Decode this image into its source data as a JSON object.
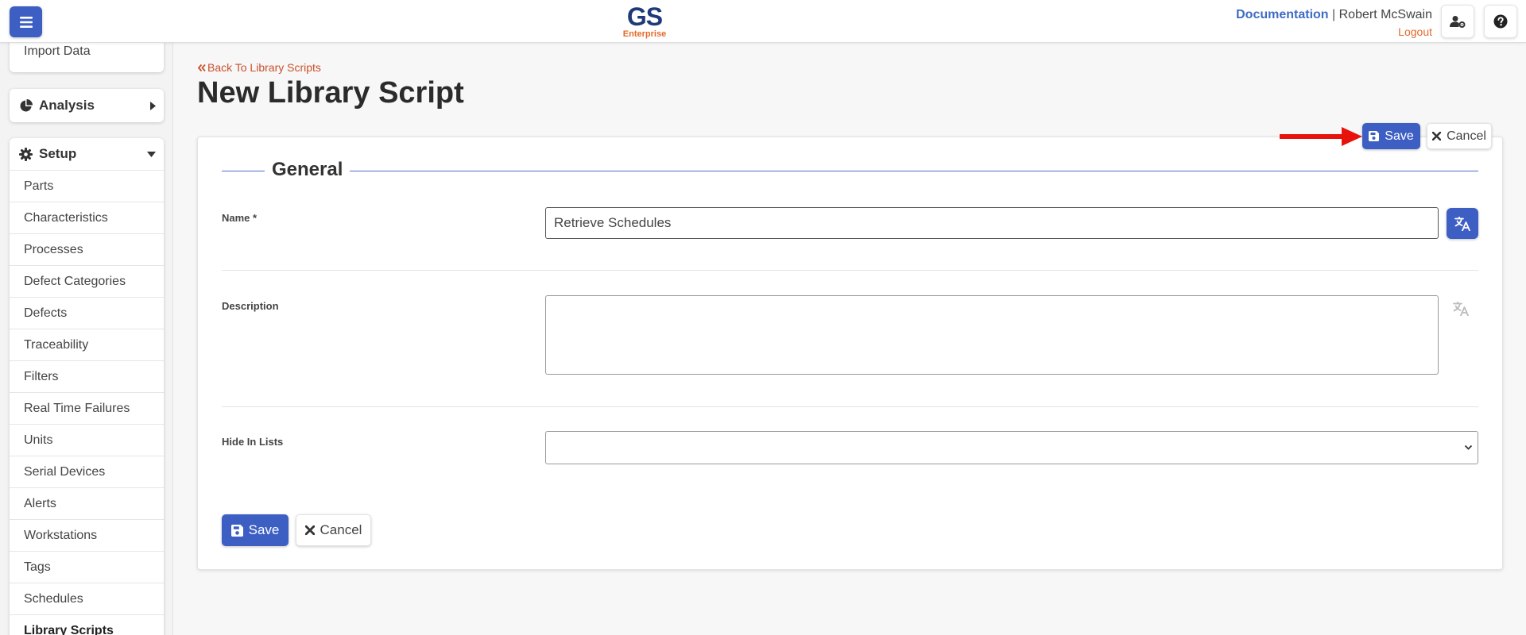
{
  "header": {
    "logo_main": "GS",
    "logo_sub": "Enterprise",
    "documentation": "Documentation",
    "separator": "|",
    "user_name": "Robert McSwain",
    "logout": "Logout",
    "icons": {
      "menu": "hamburger-icon",
      "user_settings": "user-cog-icon",
      "help": "question-circle-icon"
    }
  },
  "sidebar": {
    "import_data": "Import Data",
    "analysis": {
      "label": "Analysis",
      "icon": "chart-pie-icon"
    },
    "setup": {
      "label": "Setup",
      "icon": "gear-icon",
      "items": [
        {
          "label": "Parts"
        },
        {
          "label": "Characteristics"
        },
        {
          "label": "Processes"
        },
        {
          "label": "Defect Categories"
        },
        {
          "label": "Defects"
        },
        {
          "label": "Traceability"
        },
        {
          "label": "Filters"
        },
        {
          "label": "Real Time Failures"
        },
        {
          "label": "Units"
        },
        {
          "label": "Serial Devices"
        },
        {
          "label": "Alerts"
        },
        {
          "label": "Workstations"
        },
        {
          "label": "Tags"
        },
        {
          "label": "Schedules"
        },
        {
          "label": "Library Scripts",
          "active": true
        }
      ]
    }
  },
  "main": {
    "back_link": "Back To Library Scripts",
    "title": "New Library Script",
    "top_save": "Save",
    "top_cancel": "Cancel",
    "section_title": "General",
    "fields": {
      "name_label": "Name *",
      "name_value": "Retrieve Schedules",
      "description_label": "Description",
      "description_value": "",
      "hide_label": "Hide In Lists",
      "hide_value": ""
    },
    "bottom_save": "Save",
    "bottom_cancel": "Cancel"
  },
  "colors": {
    "primary": "#3d5fc4",
    "link_orange": "#e36a2a",
    "annotation_arrow": "#e8120c"
  }
}
